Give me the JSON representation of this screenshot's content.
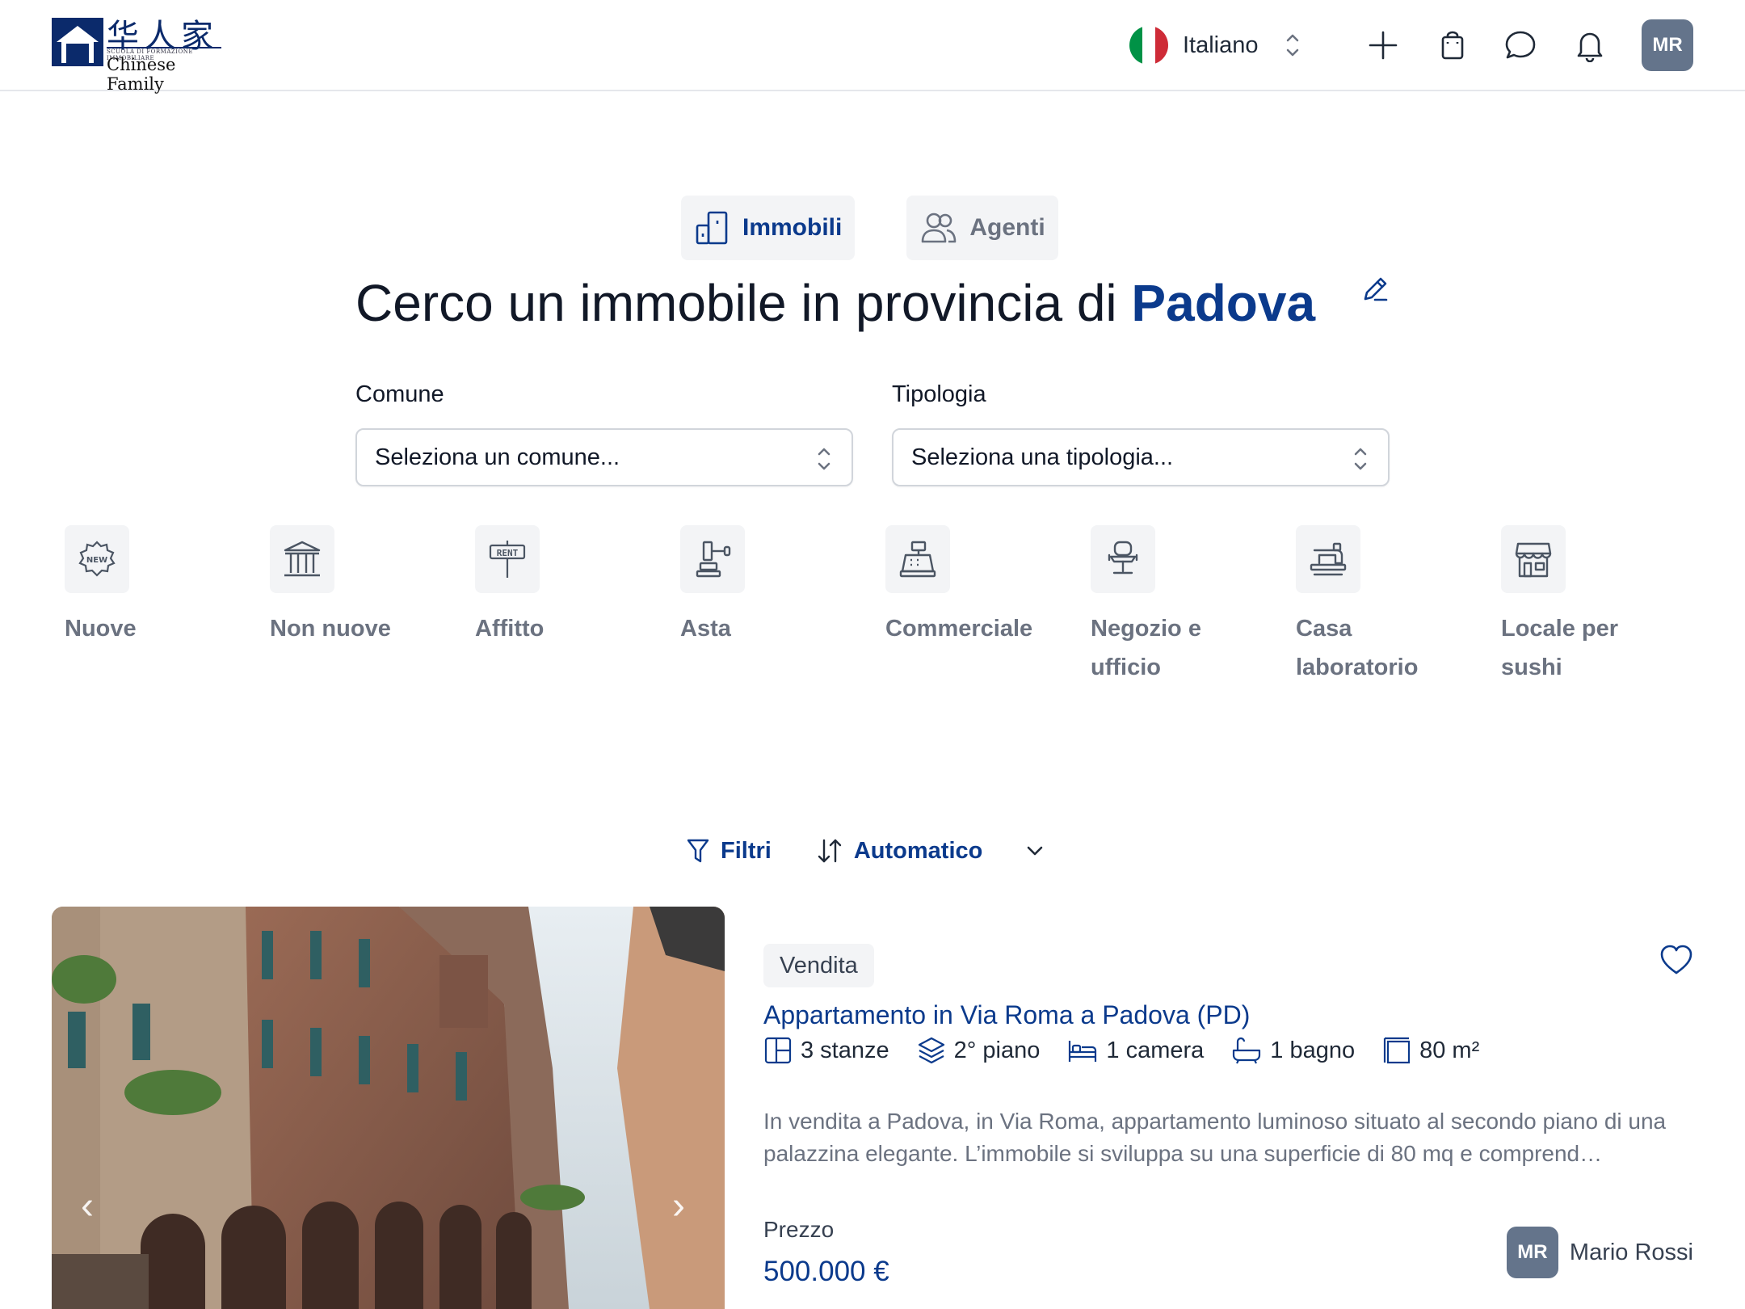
{
  "header": {
    "logo": {
      "hanzi": "华人家",
      "tagline": "SCUOLA DI FORMAZIONE IMMOBILIARE",
      "name": "Chinese Family"
    },
    "language": {
      "label": "Italiano",
      "flag_colors": [
        "#009246",
        "#ffffff",
        "#ce2b37"
      ]
    },
    "icons": [
      "plus-icon",
      "bag-icon",
      "chat-icon",
      "bell-icon"
    ],
    "avatar_initials": "MR"
  },
  "search": {
    "tabs": [
      {
        "label": "Immobili",
        "active": true
      },
      {
        "label": "Agenti",
        "active": false
      }
    ],
    "headline_prefix": "Cerco un immobile in provincia di",
    "province": "Padova",
    "comune": {
      "label": "Comune",
      "value": "Seleziona un comune..."
    },
    "tipologia": {
      "label": "Tipologia",
      "value": "Seleziona una tipologia..."
    }
  },
  "categories": [
    {
      "label": "Nuove",
      "icon": "new-badge-icon"
    },
    {
      "label": "Non nuove",
      "icon": "columns-building-icon"
    },
    {
      "label": "Affitto",
      "icon": "rent-sign-icon"
    },
    {
      "label": "Asta",
      "icon": "auction-gavel-icon"
    },
    {
      "label": "Commerciale",
      "icon": "cash-register-icon"
    },
    {
      "label": "Negozio e ufficio",
      "icon": "office-chair-icon"
    },
    {
      "label": "Casa laboratorio",
      "icon": "sewing-machine-icon"
    },
    {
      "label": "Locale per sushi",
      "icon": "storefront-icon"
    }
  ],
  "toolbar": {
    "filters_label": "Filtri",
    "sort_label": "Automatico"
  },
  "listing": {
    "badge": "Vendita",
    "title": "Appartamento in Via Roma a Padova (PD)",
    "features": [
      {
        "icon": "rooms-icon",
        "label": "3 stanze"
      },
      {
        "icon": "floor-layers-icon",
        "label": "2° piano"
      },
      {
        "icon": "bed-icon",
        "label": "1 camera"
      },
      {
        "icon": "bathtub-icon",
        "label": "1 bagno"
      },
      {
        "icon": "area-icon",
        "label": "80 m²"
      }
    ],
    "description": "In vendita a Padova, in Via Roma, appartamento luminoso situato al secondo piano di una palazzina elegante. L’immobile si sviluppa su una superficie di 80 mq e comprend…",
    "price_label": "Prezzo",
    "price": "500.000 €",
    "agent": {
      "initials": "MR",
      "name": "Mario Rossi"
    }
  },
  "colors": {
    "brand": "#0b3a8c",
    "muted": "#6b7280",
    "chip_bg": "#f3f4f6",
    "avatar_bg": "#64748b"
  }
}
